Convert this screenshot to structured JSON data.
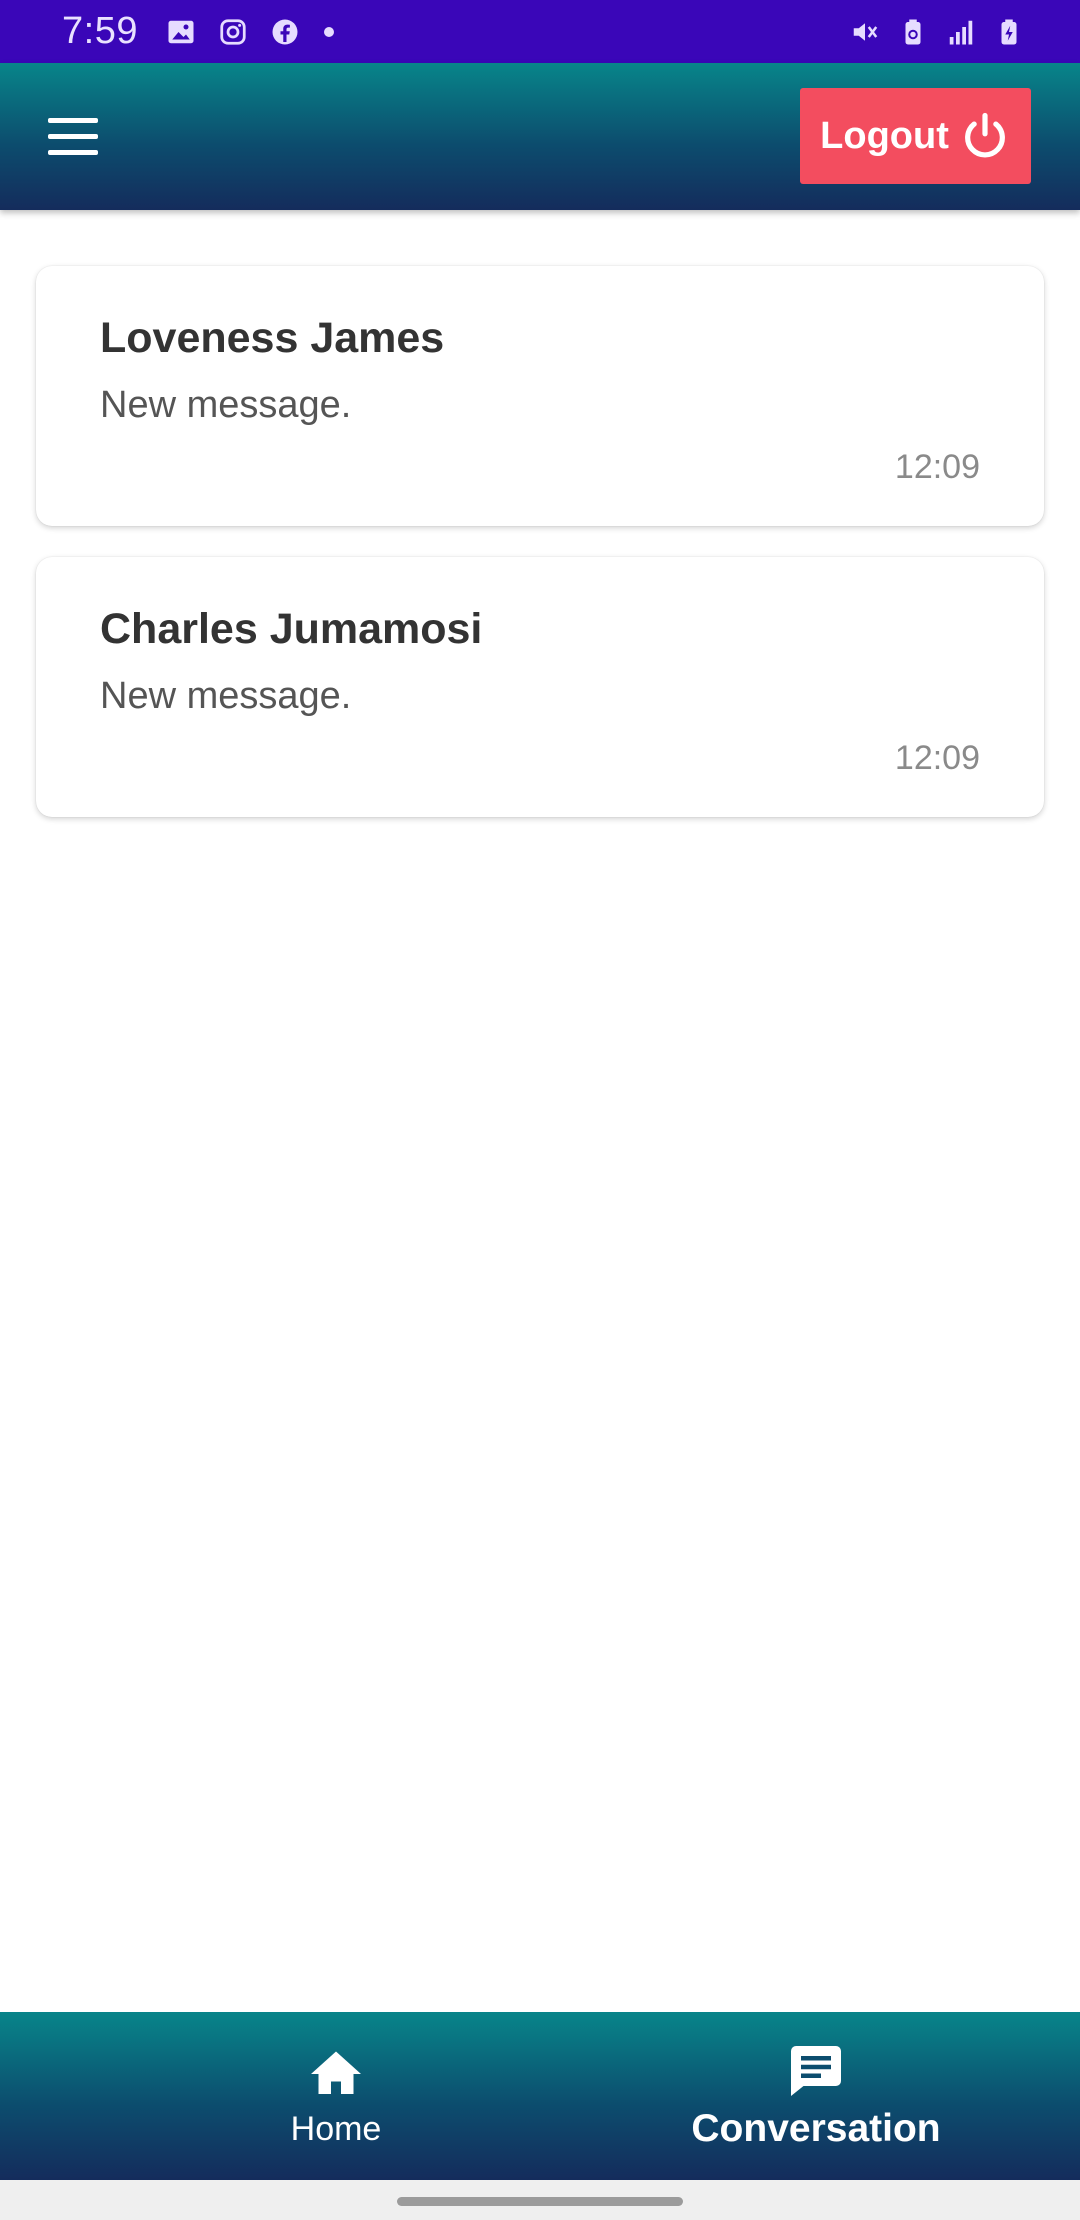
{
  "status_bar": {
    "time": "7:59",
    "left_icons": [
      "image-icon",
      "instagram-icon",
      "facebook-icon",
      "dot-icon"
    ],
    "right_icons": [
      "mute-vibrate-icon",
      "battery-saver-icon",
      "signal-icon",
      "battery-charging-icon"
    ]
  },
  "app_bar": {
    "logout_label": "Logout",
    "accent": "#f34d5f"
  },
  "conversations": [
    {
      "name": "Loveness James",
      "message": "New message.",
      "time": "12:09"
    },
    {
      "name": "Charles Jumamosi",
      "message": "New message.",
      "time": "12:09"
    }
  ],
  "bottom_nav": {
    "items": [
      {
        "label": "Home",
        "icon": "home-icon",
        "active": false
      },
      {
        "label": "Conversation",
        "icon": "chat-icon",
        "active": true
      }
    ]
  },
  "colors": {
    "status_bar": "#3a06b8",
    "gradient_top": "#08858a",
    "gradient_bottom": "#142c5c"
  }
}
